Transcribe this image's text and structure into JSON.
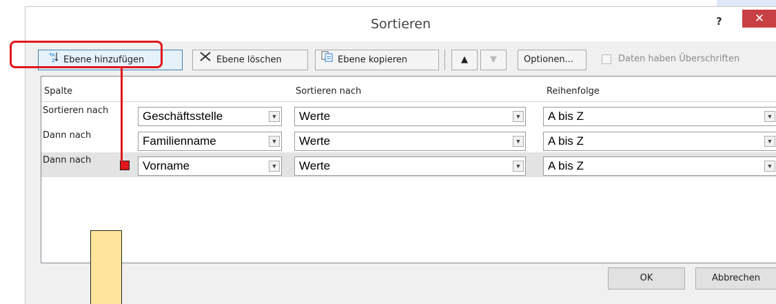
{
  "dialog": {
    "title": "Sortieren",
    "help": "?",
    "close": "✕"
  },
  "toolbar": {
    "add_level": "Ebene hinzufügen",
    "delete_level": "Ebene löschen",
    "copy_level": "Ebene kopieren",
    "move_up": "▲",
    "move_down": "▼",
    "options": "Optionen...",
    "has_headers_label": "Daten haben Überschriften",
    "has_headers_checked": false
  },
  "grid": {
    "headers": {
      "column": "Spalte",
      "sort_on": "Sortieren nach",
      "order": "Reihenfolge"
    },
    "rows": [
      {
        "label": "Sortieren nach",
        "column": "Geschäftsstelle",
        "sort_on": "Werte",
        "order": "A bis Z",
        "selected": false
      },
      {
        "label": "Dann nach",
        "column": "Familienname",
        "sort_on": "Werte",
        "order": "A bis Z",
        "selected": false
      },
      {
        "label": "Dann nach",
        "column": "Vorname",
        "sort_on": "Werte",
        "order": "A bis Z",
        "selected": true
      }
    ]
  },
  "footer": {
    "ok": "OK",
    "cancel": "Abbrechen"
  },
  "colors": {
    "highlight": "#e0161a",
    "note": "#ffe59a",
    "close_button": "#c74044"
  }
}
